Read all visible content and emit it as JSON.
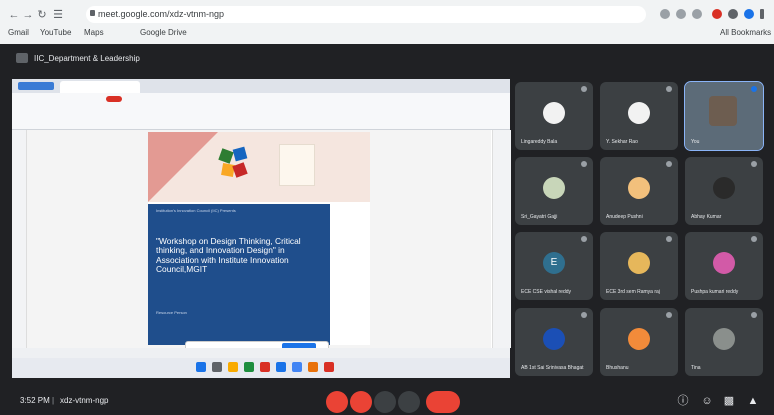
{
  "browser": {
    "url": "meet.google.com/xdz-vtnm-ngp",
    "bookmarks": [
      "Gmail",
      "YouTube",
      "Maps",
      "Google Drive"
    ],
    "bookmark_right": "All Bookmarks"
  },
  "meeting": {
    "title": "IIC_Department & Leadership",
    "time": "3:52 PM",
    "separator": "|",
    "code": "xdz-vtnm-ngp"
  },
  "slide": {
    "subheading": "Institution's Innovation Council (IIC) Presents",
    "heading": "\"Workshop on Design Thinking, Critical thinking, and Innovation Design\" in Association with Institute Innovation Council,MGIT",
    "footer": "Resource Person"
  },
  "participants": [
    {
      "name": "Lingareddy Bala",
      "color": "#f2f2f2"
    },
    {
      "name": "Y. Sekhar Rao",
      "color": "#f2f2f2"
    },
    {
      "name": "You",
      "color": "#f2f2f2"
    },
    {
      "name": "Sri_Gayatri Gajji",
      "color": "#c8d6b9"
    },
    {
      "name": "Anudeep Pushni",
      "color": "#f2c07c"
    },
    {
      "name": "Abhay Kumar",
      "color": "#2a2a2a"
    },
    {
      "name": "ECE CSE vishal reddy",
      "color": "#2f6f8f"
    },
    {
      "name": "ECE 3rd sem Ramya raj",
      "color": "#e6b75b"
    },
    {
      "name": "Pushpa kumari reddy",
      "color": "#d25aa7"
    },
    {
      "name": "AB 1st Sai Srinivasa Bhagat",
      "color": "#1b4fb5"
    },
    {
      "name": "Bhushanu",
      "color": "#f28b3a"
    },
    {
      "name": "Tina",
      "color": "#8a8f8c"
    }
  ],
  "tile_letters": {
    "e": "E"
  },
  "controls": [
    "mic-off",
    "camera-off",
    "present",
    "more",
    "leave"
  ],
  "colors": {
    "leave": "#ea4335",
    "mic_off": "#ea4335",
    "blue": "#1a73e8"
  }
}
